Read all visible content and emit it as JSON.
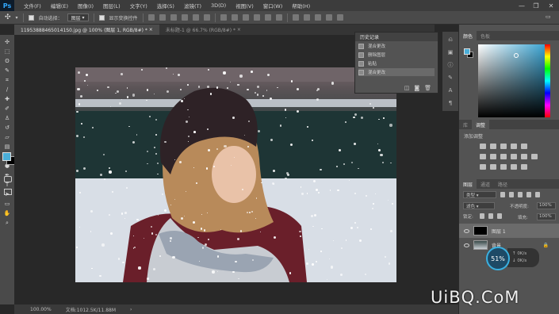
{
  "menubar": {
    "logo": "Ps",
    "items": [
      "文件(F)",
      "编辑(E)",
      "图像(I)",
      "图层(L)",
      "文字(Y)",
      "选择(S)",
      "滤镜(T)",
      "3D(D)",
      "视图(V)",
      "窗口(W)",
      "帮助(H)"
    ],
    "minimize": "—",
    "restore": "❐",
    "close": "✕"
  },
  "options": {
    "auto_select": "自动选择：",
    "target": "图层",
    "show_transform": "显示变换控件"
  },
  "tabs": [
    {
      "label": "119538884650141S0.jpg @ 100% (图层 1, RGB/8#) *"
    },
    {
      "label": "未标题-1 @ 66.7% (RGB/8#) *"
    }
  ],
  "history": {
    "title": "历史记录",
    "rows": [
      "混合更改",
      "删除图层",
      "粘贴",
      "混合更改"
    ]
  },
  "color_panel": {
    "tabs": [
      "颜色",
      "色板"
    ],
    "fg": "#4aaed8",
    "bg": "#000000"
  },
  "adjust_panel": {
    "tabs": [
      "库",
      "调整"
    ],
    "title": "添加调整"
  },
  "layers_panel": {
    "tabs": [
      "图层",
      "通道",
      "路径"
    ],
    "kind": "类型",
    "blend": "滤色",
    "opacity_label": "不透明度:",
    "opacity": "100%",
    "lock_label": "锁定:",
    "fill_label": "填充:",
    "fill": "100%",
    "layers": [
      {
        "name": "图层 1"
      },
      {
        "name": "背景"
      }
    ]
  },
  "gauge": {
    "value": "51%",
    "up": "0K/s",
    "down": "0K/s"
  },
  "status": {
    "zoom": "100.00%",
    "doc": "文档:1012.5K/11.88M"
  },
  "watermark": "UiBQ.CoM"
}
